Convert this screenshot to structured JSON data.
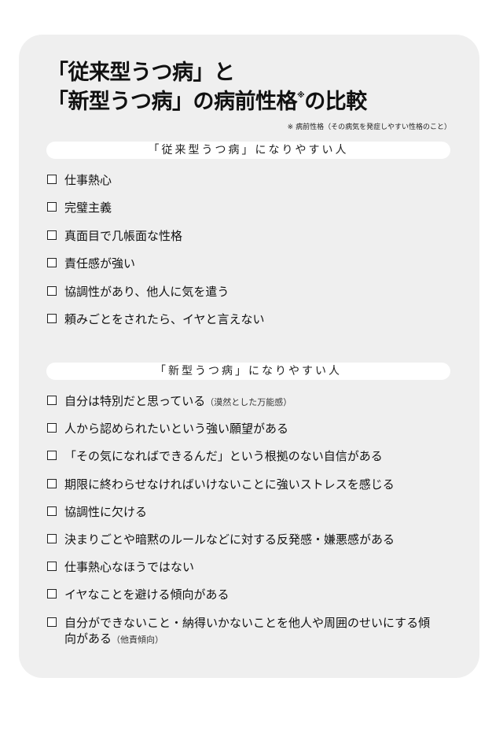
{
  "title": {
    "line1": "「従来型うつ病」と",
    "line2": "「新型うつ病」の病前性格",
    "mark": "※",
    "line2_suffix": "の比較"
  },
  "footnote": "※ 病前性格（その病気を発症しやすい性格のこと）",
  "section_a": {
    "header": "「従来型うつ病」になりやすい人",
    "items": [
      "仕事熱心",
      "完璧主義",
      "真面目で几帳面な性格",
      "責任感が強い",
      "協調性があり、他人に気を遣う",
      "頼みごとをされたら、イヤと言えない"
    ]
  },
  "section_b": {
    "header": "「新型うつ病」になりやすい人",
    "items": [
      {
        "text": "自分は特別だと思っている",
        "note": "（漠然とした万能感）"
      },
      {
        "text": "人から認められたいという強い願望がある",
        "note": ""
      },
      {
        "text": "「その気になればできるんだ」という根拠のない自信がある",
        "note": ""
      },
      {
        "text": "期限に終わらせなければいけないことに強いストレスを感じる",
        "note": ""
      },
      {
        "text": "協調性に欠ける",
        "note": ""
      },
      {
        "text": "決まりごとや暗黙のルールなどに対する反発感・嫌悪感がある",
        "note": ""
      },
      {
        "text": "仕事熱心なほうではない",
        "note": ""
      },
      {
        "text": "イヤなことを避ける傾向がある",
        "note": ""
      },
      {
        "text": "自分ができないこと・納得いかないことを他人や周囲のせいにする傾向がある",
        "note": "（他責傾向）"
      }
    ]
  }
}
